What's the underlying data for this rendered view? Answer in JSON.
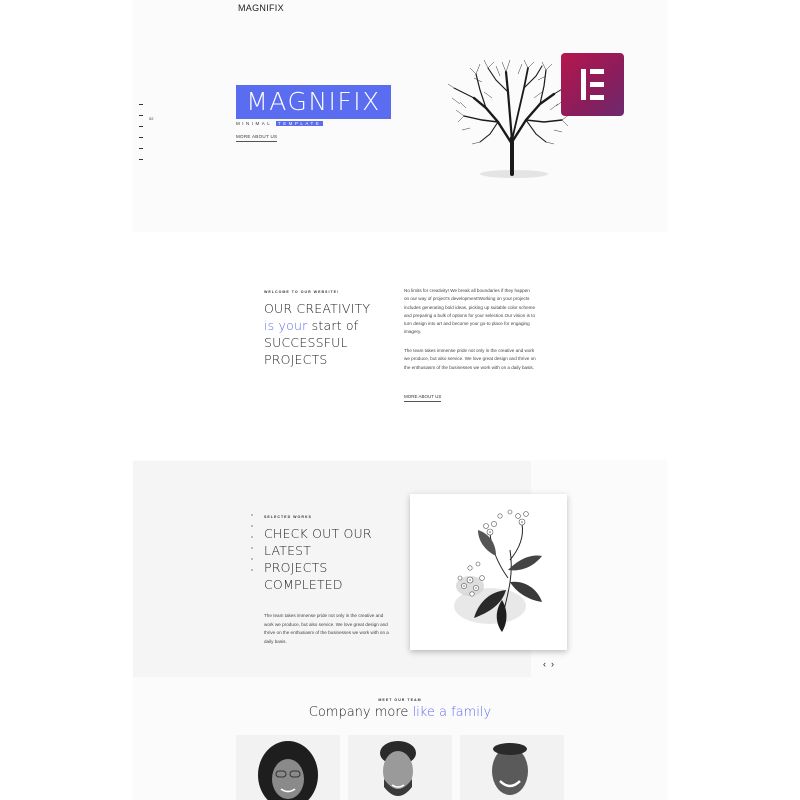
{
  "header": {
    "logo": "MAGNIFIX"
  },
  "side_nav": {
    "current_page": "02"
  },
  "hero": {
    "title": "MAGNIFIX",
    "subtitle_part1": "MINIMAL ",
    "subtitle_part2": "TEMPLATE",
    "more_link": "MORE ABOUT US"
  },
  "about": {
    "eyebrow": "WELCOME TO OUR WEBSITE!",
    "heading_line1": "OUR CREATIVITY",
    "heading_accent": "is your",
    "heading_line2_rest": " start of",
    "heading_line3": "SUCCESSFUL",
    "heading_line4": "PROJECTS",
    "paragraph1": "No limits for creativity! We break all boundaries if they happen on our way of project's development!Working on your projects includes generating bold ideas, picking up suitable color scheme and preparing a bulk of options for your selection.Our vision is to turn design into art and become your go-to place for engaging imagery.",
    "paragraph2": "The team takes immense pride not only in the creative and work we produce, but also service. We love great design and thrive on the enthusiasm of the businesses we work with on a daily basis.",
    "more_link": "MORE ABOUT US"
  },
  "works": {
    "eyebrow": "SELECTED WORKS",
    "heading_line1": "CHECK OUT OUR",
    "heading_line2": "LATEST",
    "heading_line3": "PROJECTS",
    "heading_line4": "COMPLETED",
    "paragraph": "The team takes immense pride not only in the creative and work we produce, but also service. We love great design and thrive on the enthusiasm of the businesses we work with on a daily basis.",
    "prev_label": "‹",
    "next_label": "›"
  },
  "team": {
    "eyebrow": "MEET OUR TEAM",
    "heading_plain": "Company more ",
    "heading_accent": "like a family"
  },
  "colors": {
    "accent": "#5a6cf0",
    "badge": "#b5174e"
  },
  "icons": [
    "elementor-logo-icon",
    "tree-icon",
    "flower-icon",
    "chevron-left-icon",
    "chevron-right-icon"
  ]
}
